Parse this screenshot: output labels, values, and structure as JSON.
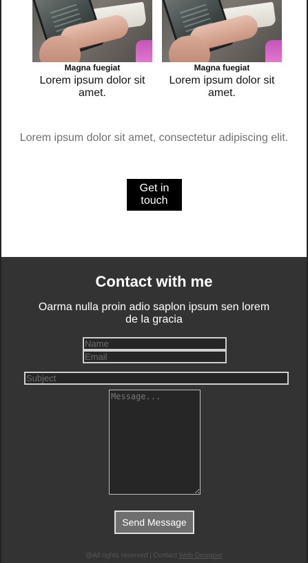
{
  "cards": [
    {
      "title": "Magna fuegiat",
      "text": "Lorem ipsum dolor sit amet."
    },
    {
      "title": "Magna fuegiat",
      "text": "Lorem ipsum dolor sit amet."
    }
  ],
  "tagline": "Lorem ipsum dolor sit amet, consectetur adipiscing elit.",
  "cta_label": "Get in touch",
  "contact": {
    "title": "Contact with me",
    "subtitle": "Oarma nulla proin adio saplon ipsum sen lorem de la gracia",
    "name_placeholder": "Name",
    "email_placeholder": "Email",
    "subject_placeholder": "Subject",
    "message_placeholder": "Message...",
    "send_label": "Send Message"
  },
  "footer": {
    "text": "@All rights reserved | Contact",
    "link_label": "Web Designer"
  },
  "colors": {
    "contact_bg": "#333333",
    "cta_bg": "#000000",
    "send_bg": "#6e6e6e"
  }
}
